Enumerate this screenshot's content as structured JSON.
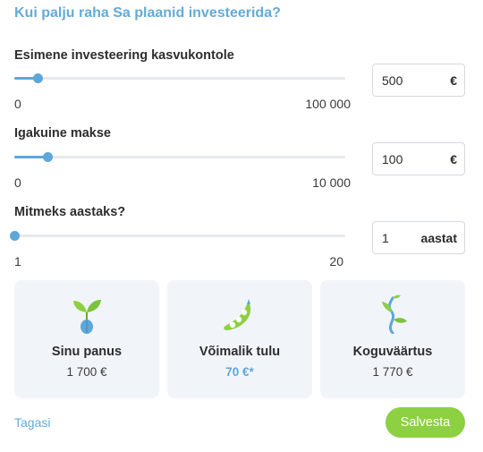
{
  "title": "Kui palju raha Sa plaanid investeerida?",
  "sliders": [
    {
      "label": "Esimene investeering kasvukontole",
      "min_label": "0",
      "max_label": "100 000",
      "min": 0,
      "max": 100000,
      "value": 500,
      "input_value": "500",
      "unit": "€"
    },
    {
      "label": "Igakuine makse",
      "min_label": "0",
      "max_label": "10 000",
      "min": 0,
      "max": 10000,
      "value": 100,
      "input_value": "100",
      "unit": "€"
    },
    {
      "label": "Mitmeks aastaks?",
      "min_label": "1",
      "max_label": "20",
      "min": 1,
      "max": 20,
      "value": 1,
      "input_value": "1",
      "unit": "aastat"
    }
  ],
  "cards": [
    {
      "icon": "sprout-icon",
      "title": "Sinu panus",
      "value": "1 700 €"
    },
    {
      "icon": "peapod-icon",
      "title": "Võimalik tulu",
      "value": "70 €*"
    },
    {
      "icon": "growing-plant-icon",
      "title": "Koguväärtus",
      "value": "1 770 €"
    }
  ],
  "footer": {
    "back_label": "Tagasi",
    "save_label": "Salvesta"
  },
  "colors": {
    "accent": "#5ea7d8",
    "save": "#8dd042",
    "card_bg": "#f1f5f9",
    "leaf": "#8dd042"
  }
}
